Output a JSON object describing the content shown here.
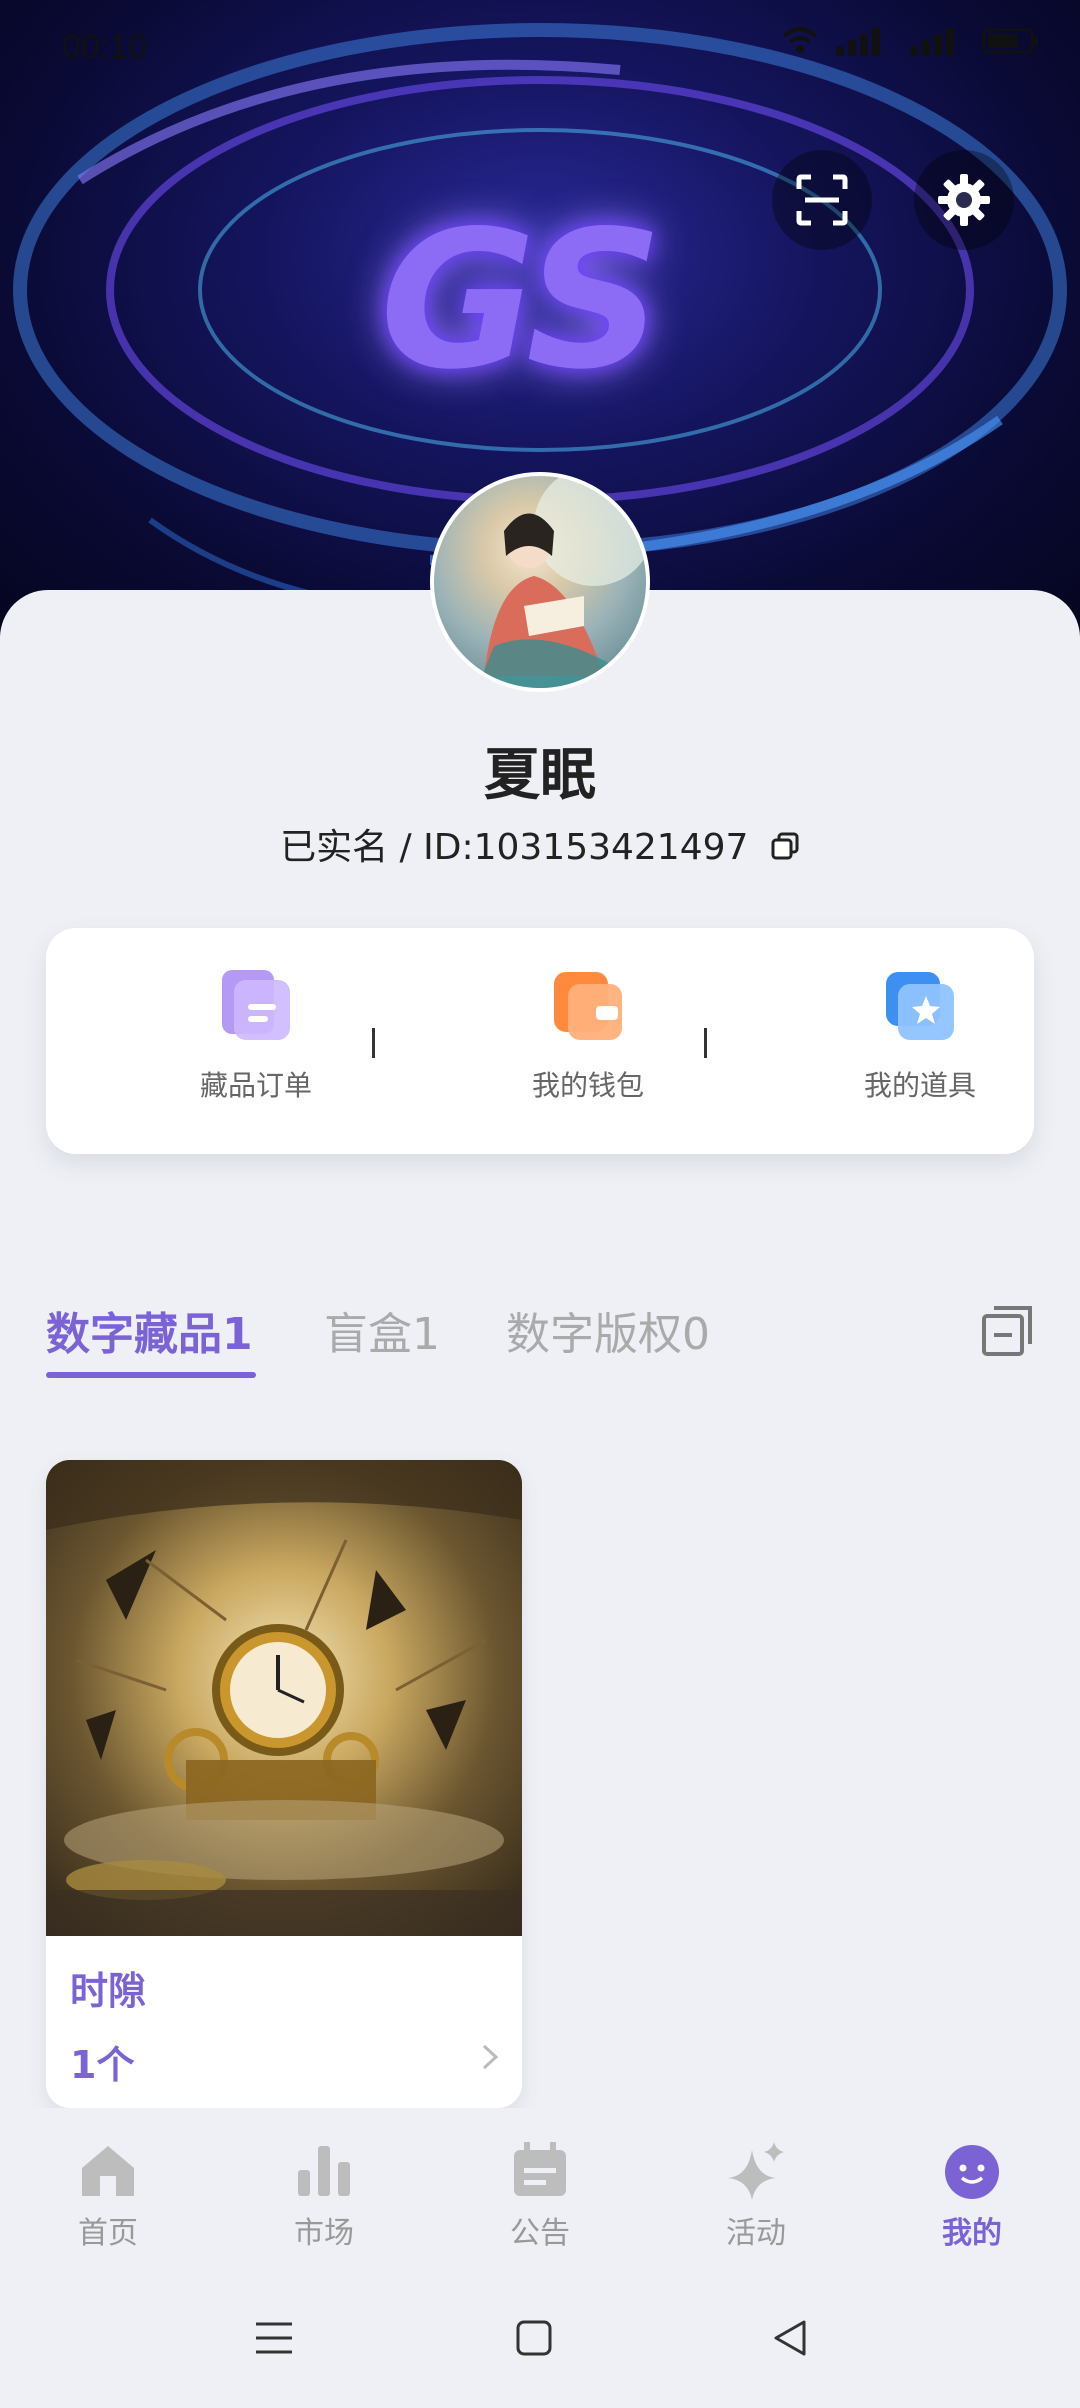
{
  "status_bar": {
    "time": "00:10"
  },
  "header": {
    "logo_text": "GS",
    "scan_icon": "scan-icon",
    "settings_icon": "gear-icon"
  },
  "profile": {
    "name": "夏眠",
    "id_line": "已实名 / ID:103153421497"
  },
  "quick_actions": [
    {
      "label": "藏品订单",
      "icon": "orders-icon",
      "color": "#a98af0"
    },
    {
      "label": "我的钱包",
      "icon": "wallet-icon",
      "color": "#ff9d5c"
    },
    {
      "label": "我的道具",
      "icon": "props-icon",
      "color": "#5aa6f5"
    }
  ],
  "tabs": [
    {
      "label": "数字藏品1",
      "active": true
    },
    {
      "label": "盲盒1",
      "active": false
    },
    {
      "label": "数字版权0",
      "active": false
    }
  ],
  "collection": [
    {
      "title": "时隙",
      "count": "1个"
    }
  ],
  "bottom_nav": [
    {
      "label": "首页",
      "icon": "home-icon"
    },
    {
      "label": "市场",
      "icon": "bar-chart-icon"
    },
    {
      "label": "公告",
      "icon": "calendar-icon"
    },
    {
      "label": "活动",
      "icon": "sparkle-icon"
    },
    {
      "label": "我的",
      "icon": "smiley-icon",
      "active": true
    }
  ],
  "colors": {
    "accent": "#7b63d6",
    "background": "#eef0f5"
  }
}
